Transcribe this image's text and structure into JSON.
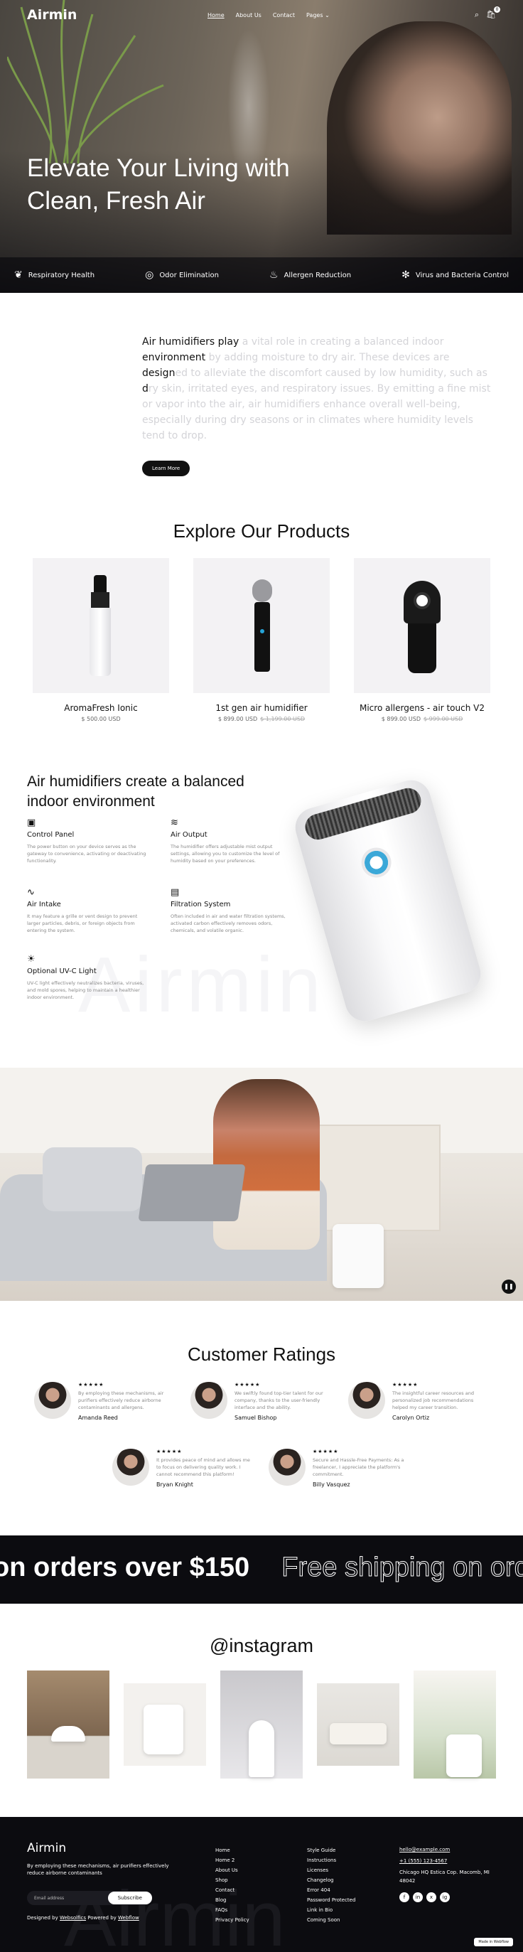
{
  "nav": {
    "logo": "Airmin",
    "links": [
      "Home",
      "About Us",
      "Contact",
      "Pages"
    ],
    "cart_count": "0"
  },
  "hero": {
    "title": "Elevate Your Living with Clean, Fresh Air",
    "features": [
      "Respiratory Health",
      "Odor Elimination",
      "Allergen Reduction",
      "Virus and Bacteria Control"
    ]
  },
  "intro": {
    "text_dark": [
      "Air humidifiers play",
      "environment",
      "design",
      "d"
    ],
    "text_light": [
      " a vital role in creating a balanced indoor",
      " by adding moisture to dry air. These devices are",
      "ed to alleviate the discomfort caused by low humidity, such as ",
      "ry skin, irritated eyes, and respiratory issues. By emitting a fine mist or vapor into the air, air humidifiers enhance overall well-being, especially during dry seasons or in climates where humidity levels tend to drop."
    ],
    "button": "Learn More"
  },
  "products": {
    "title": "Explore Our Products",
    "items": [
      {
        "name": "AromaFresh Ionic",
        "price": "$ 500.00 USD",
        "old": ""
      },
      {
        "name": "1st gen air humidifier",
        "price": "$ 899.00 USD",
        "old": "$ 1,199.00 USD"
      },
      {
        "name": "Micro allergens - air touch V2",
        "price": "$ 899.00 USD",
        "old": "$ 999.00 USD"
      }
    ]
  },
  "balanced": {
    "title": "Air humidifiers create a balanced indoor environment",
    "bg_word": "Airmin",
    "specs": [
      {
        "title": "Control Panel",
        "desc": "The power button on your device serves as the gateway to convenience, activating or deactivating functionality."
      },
      {
        "title": "Air Output",
        "desc": "The humidifier offers adjustable mist output settings, allowing you to customize the level of humidity based on your preferences."
      },
      {
        "title": "Air Intake",
        "desc": "It may feature a grille or vent design to prevent larger particles, debris, or foreign objects from entering the system."
      },
      {
        "title": "Filtration System",
        "desc": "Often included in air and water filtration systems, activated carbon effectively removes odors, chemicals, and volatile organic."
      },
      {
        "title": "Optional UV-C Light",
        "desc": "UV-C light effectively neutralizes bacteria, viruses, and mold spores, helping to maintain a healthier indoor environment."
      }
    ]
  },
  "ratings": {
    "title": "Customer Ratings",
    "stars": "★★★★★",
    "reviews": [
      {
        "name": "Amanda Reed",
        "text": "By employing these mechanisms, air purifiers effectively reduce airborne contaminants and allergens."
      },
      {
        "name": "Samuel Bishop",
        "text": "We swiftly found top-tier talent for our company, thanks to the user-friendly interface and the ability."
      },
      {
        "name": "Carolyn Ortiz",
        "text": "The insightful career resources and personalized job recommendations helped my career transition."
      },
      {
        "name": "Bryan Knight",
        "text": "It provides peace of mind and allows me to focus on delivering quality work. I cannot recommend this platform!"
      },
      {
        "name": "Billy Vasquez",
        "text": "Secure and Hassle-Free Payments: As a freelancer, I appreciate the platform's commitment."
      }
    ]
  },
  "marquee": {
    "solid": "on orders over $150",
    "outline": "Free shipping on orders"
  },
  "instagram": {
    "title": "@instagram"
  },
  "footer": {
    "logo": "Airmin",
    "tagline": "By employing these mechanisms, air purifiers effectively reduce airborne contaminants",
    "email_placeholder": "Email address",
    "subscribe": "Subscribe",
    "credit_prefix": "Designed by ",
    "credit_designer": "Websolfics",
    "credit_mid": " Powered by ",
    "credit_platform": "Webflow",
    "col1": [
      "Home",
      "Home 2",
      "About Us",
      "Shop",
      "Contact",
      "Blog",
      "FAQs",
      "Privacy Policy"
    ],
    "col2": [
      "Style Guide",
      "Instructions",
      "Licenses",
      "Changelog",
      "Error 404",
      "Password Protected",
      "Link in Bio",
      "Coming Soon"
    ],
    "email": "hello@example.com",
    "phone": "+1 (555) 123-4567",
    "address": "Chicago HQ Estica Cop. Macomb, MI 48042",
    "social": [
      "f",
      "in",
      "x",
      "ig"
    ],
    "big_word": "Airmin",
    "badge": "Made in Webflow"
  }
}
